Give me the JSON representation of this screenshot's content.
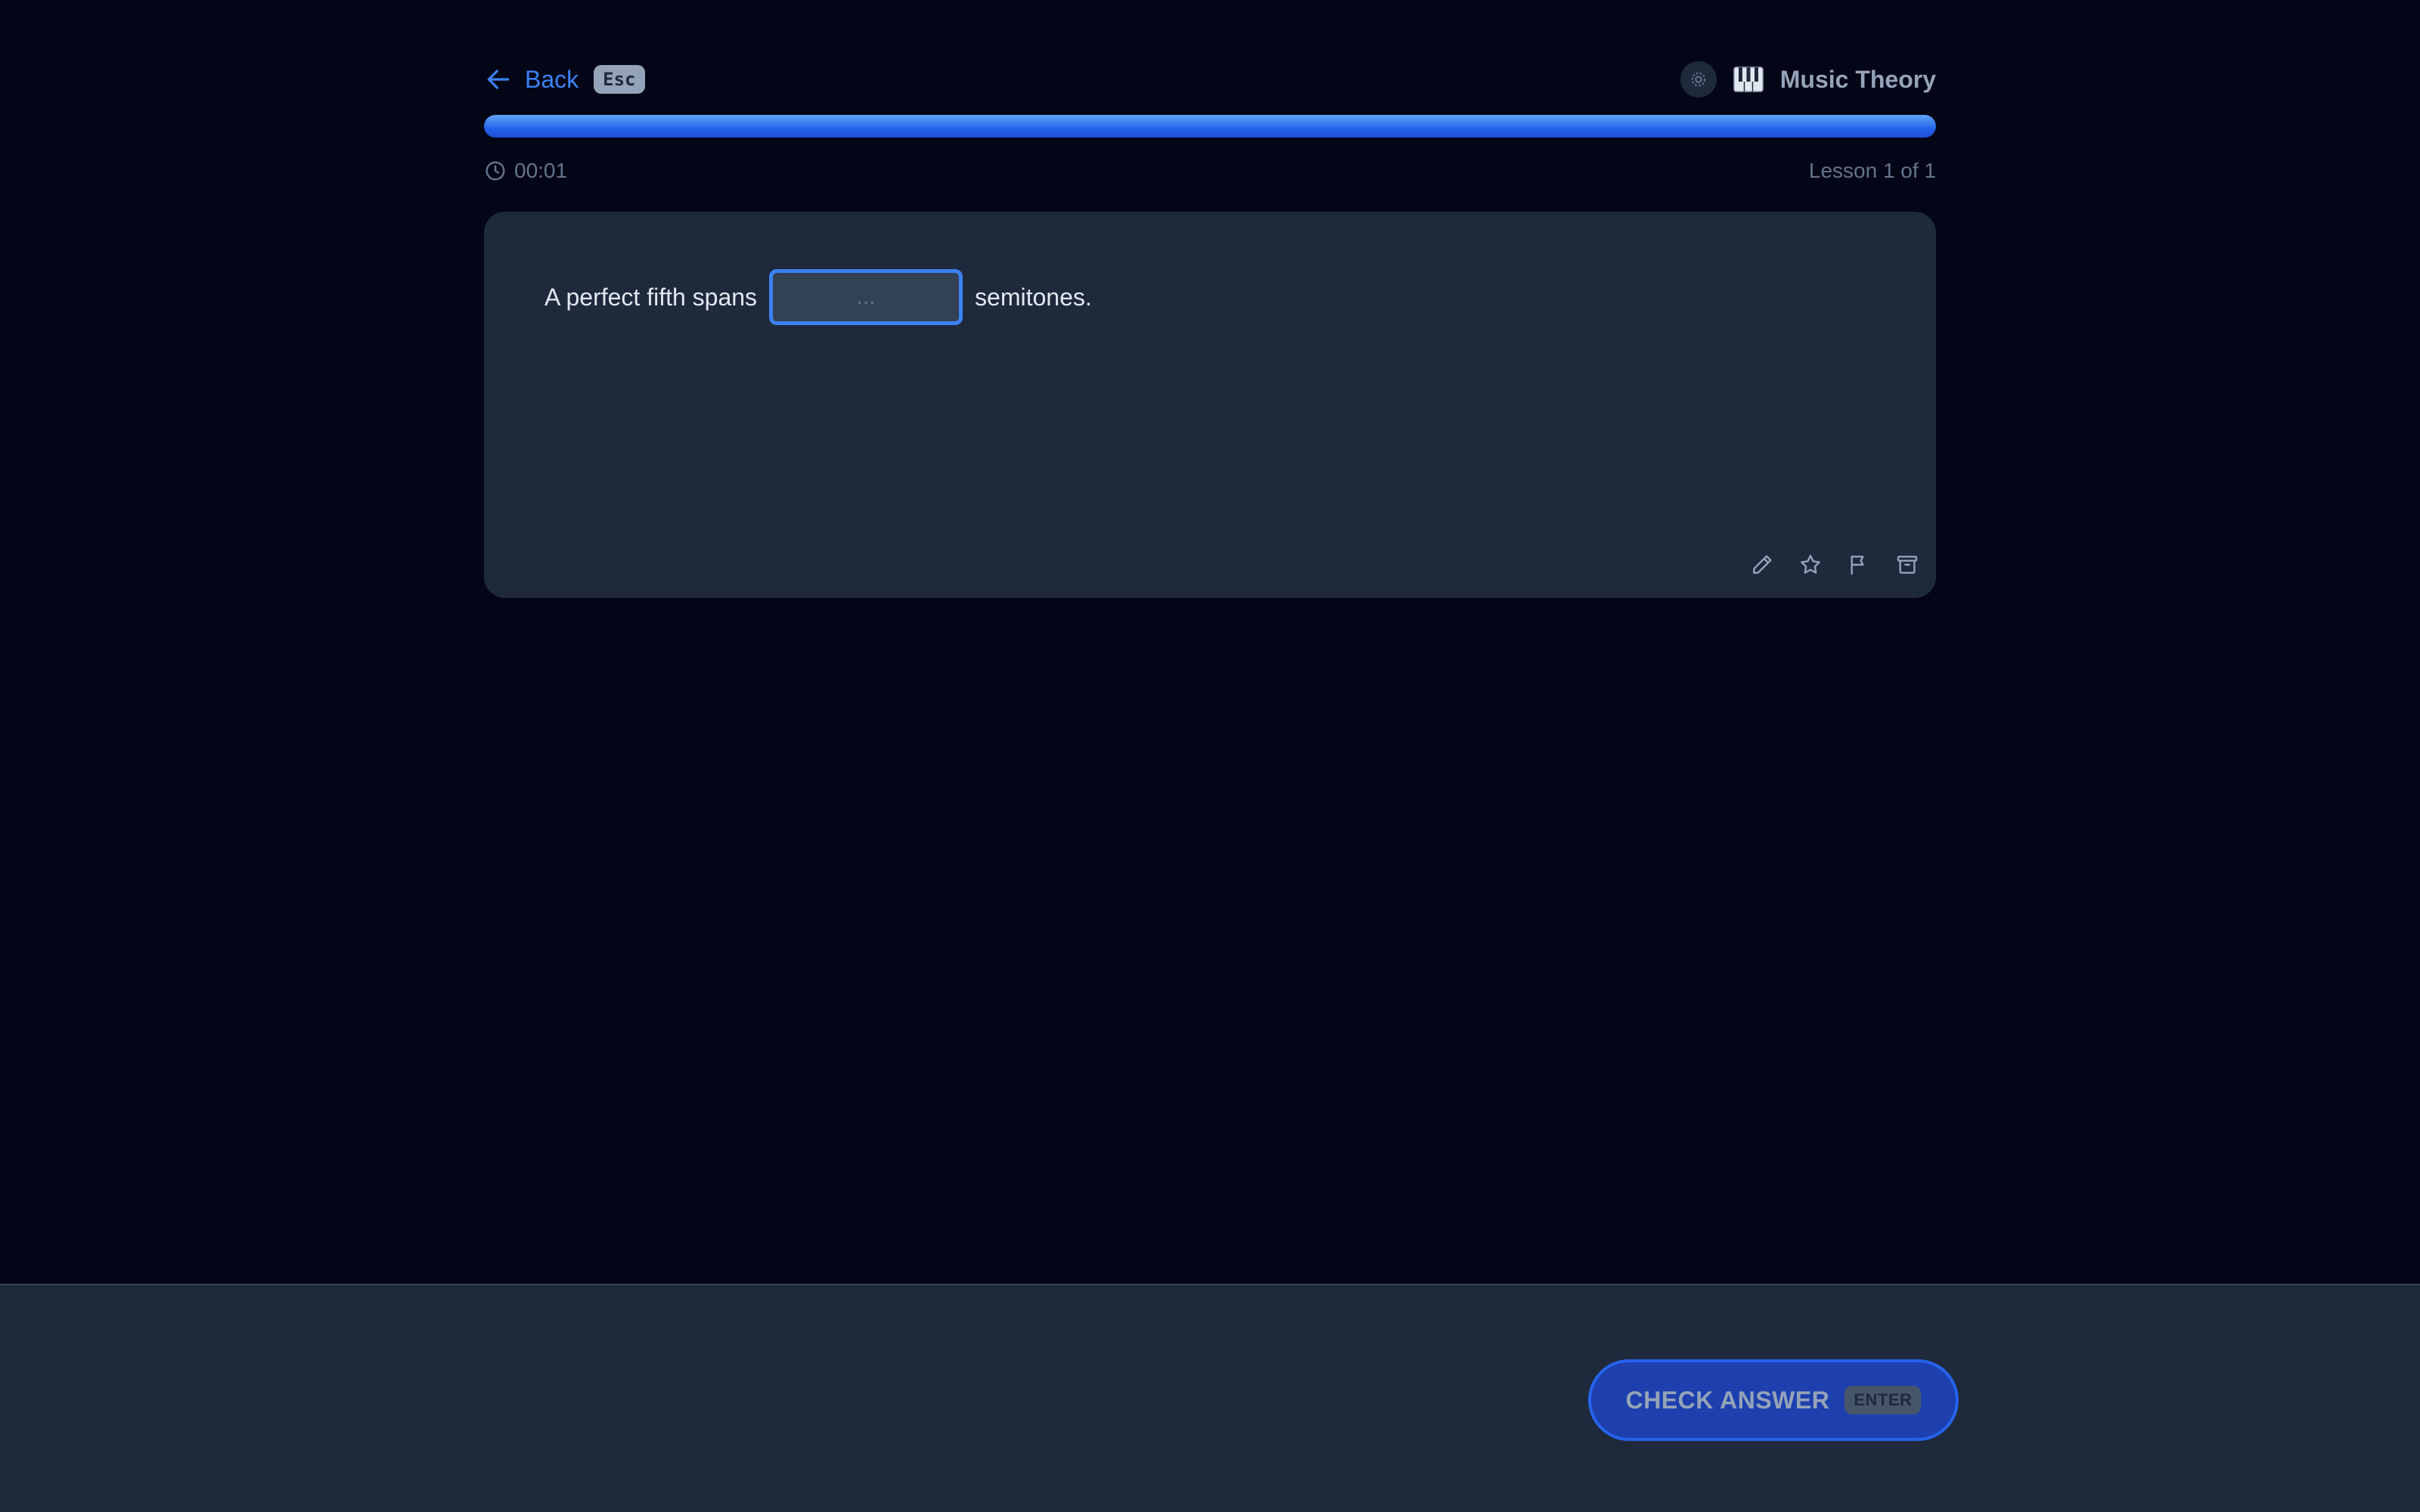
{
  "header": {
    "back_label": "Back",
    "back_shortcut": "Esc",
    "course_title": "Music Theory",
    "course_icon": "piano-icon"
  },
  "progress": {
    "fraction": 1.0
  },
  "meta": {
    "timer": "00:01",
    "lesson_counter": "Lesson 1 of 1"
  },
  "question": {
    "prefix": "A perfect fifth spans",
    "blank_placeholder": "...",
    "blank_value": "",
    "suffix": "semitones."
  },
  "card_actions": [
    "edit-icon",
    "star-icon",
    "flag-icon",
    "archive-icon"
  ],
  "footer": {
    "check_label": "CHECK ANSWER",
    "check_shortcut": "ENTER"
  },
  "colors": {
    "background": "#030617",
    "card": "#1e293b",
    "accent": "#3b82f6"
  }
}
